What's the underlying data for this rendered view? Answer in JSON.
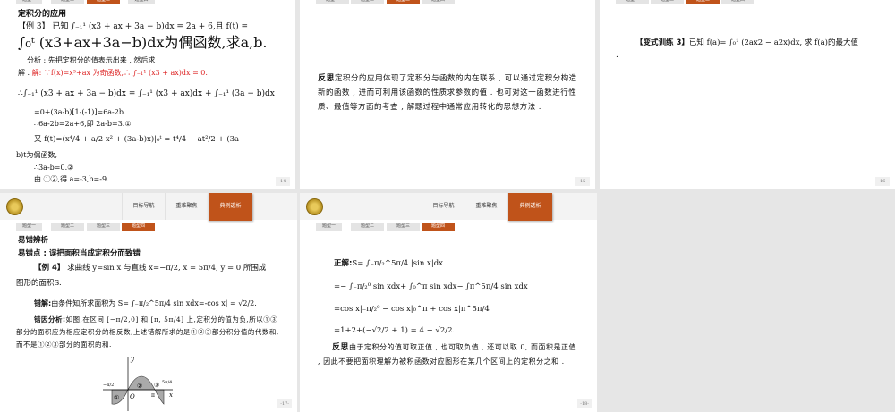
{
  "nav": [
    "目标导航",
    "重难聚焦",
    "典例透析"
  ],
  "tabs": [
    "题型一",
    "题型二",
    "题型三",
    "题型四"
  ],
  "slide14": {
    "heading": "定积分的应用",
    "lines": [
      "【例 3】 已知 ∫₋₁¹ (x3 + ax + 3a − b)dx = 2a + 6,且 f(t) =",
      "∫₀ᵗ (x3+ax+3a−b)dx为偶函数,求a,b.",
      "分析 : 先把定积分的值表示出来 , 然后求",
      "解 . ",
      "解: ∵f(x)=x³+ax 为奇函数,∴ ∫₋₁¹ (x3 + ax)dx = 0.",
      "∴∫₋₁¹ (x3 + ax + 3a − b)dx = ∫₋₁¹ (x3 + ax)dx + ∫₋₁¹ (3a − b)dx",
      "=0+(3a-b)[1-(-1)]=6a-2b.",
      "∴6a-2b=2a+6,即 2a-b=3.①",
      "又 f(t)=(x⁴/4 + a/2 x² + (3a-b)x)|₀ᵗ = t⁴/4 + at²/2 + (3a −",
      "b)t为偶函数,",
      "∴3a-b=0.②",
      "由 ①②,得 a=-3,b=-9."
    ],
    "page": "-14-"
  },
  "slide15": {
    "label": "反思",
    "text": "定积分的应用体现了定积分与函数的内在联系 , 可以通过定积分构造新的函数 , 进而可利用该函数的性质求参数的值 . 也可对这一函数进行性质、最值等方面的考查 , 解题过程中通常应用转化的思想方法 .",
    "page": "-15-"
  },
  "slide16": {
    "label": "【变式训练 3】",
    "text": "已知 f(a)= ∫₀¹ (2ax2 − a2x)dx, 求 f(a)的最大值",
    "tail": ".",
    "page": "-16-"
  },
  "slide17": {
    "heading": "易错辨析",
    "subheading": "易错点 : 误把面积当成定积分而致错",
    "example_label": "【例 4】",
    "example": " 求曲线 y=sin x 与直线 x=−π/2, x = 5π/4, y = 0 所围成",
    "example2": "图形的面积S.",
    "wrong_label": "错解:",
    "wrong": "由条件知所求面积为 S= ∫₋π/₂^5π/4 sin xdx=-cos x| = √2/2.",
    "reason_label": "错因分析:",
    "reason": "如图,在区间 [−π/2,0] 和 [π, 5π/4] 上,定积分的值为负,所以①③部分的面积应为相应定积分的相反数,上述错解所求的是①②③部分积分值的代数和,而不是①②③部分的面积的和.",
    "graph_labels": {
      "y": "y",
      "x": "x",
      "o": "O",
      "pi": "π",
      "left": "−π/2",
      "right": "5π/4",
      "r1": "①",
      "r2": "②",
      "r3": "③"
    },
    "page": "-17-"
  },
  "slide18": {
    "correct_label": "正解:",
    "lines": [
      "S= ∫₋π/₂^5π/4 |sin x|dx",
      "=− ∫₋π/₂⁰ sin xdx+ ∫₀^π sin xdx− ∫π^5π/4 sin xdx",
      "=cos x|₋π/₂⁰ − cos x|₀^π + cos x|π^5π/4",
      "=1+2+(−√2/2 + 1) = 4 − √2/2."
    ],
    "reflect_label": "反思",
    "reflect": "由于定积分的值可取正值 , 也可取负值 , 还可以取 0, 而面积是正值 , 因此不要把面积理解为被积函数对应图形在某几个区间上的定积分之和 .",
    "page": "-18-"
  },
  "colors": {
    "accent": "#c0531a"
  }
}
